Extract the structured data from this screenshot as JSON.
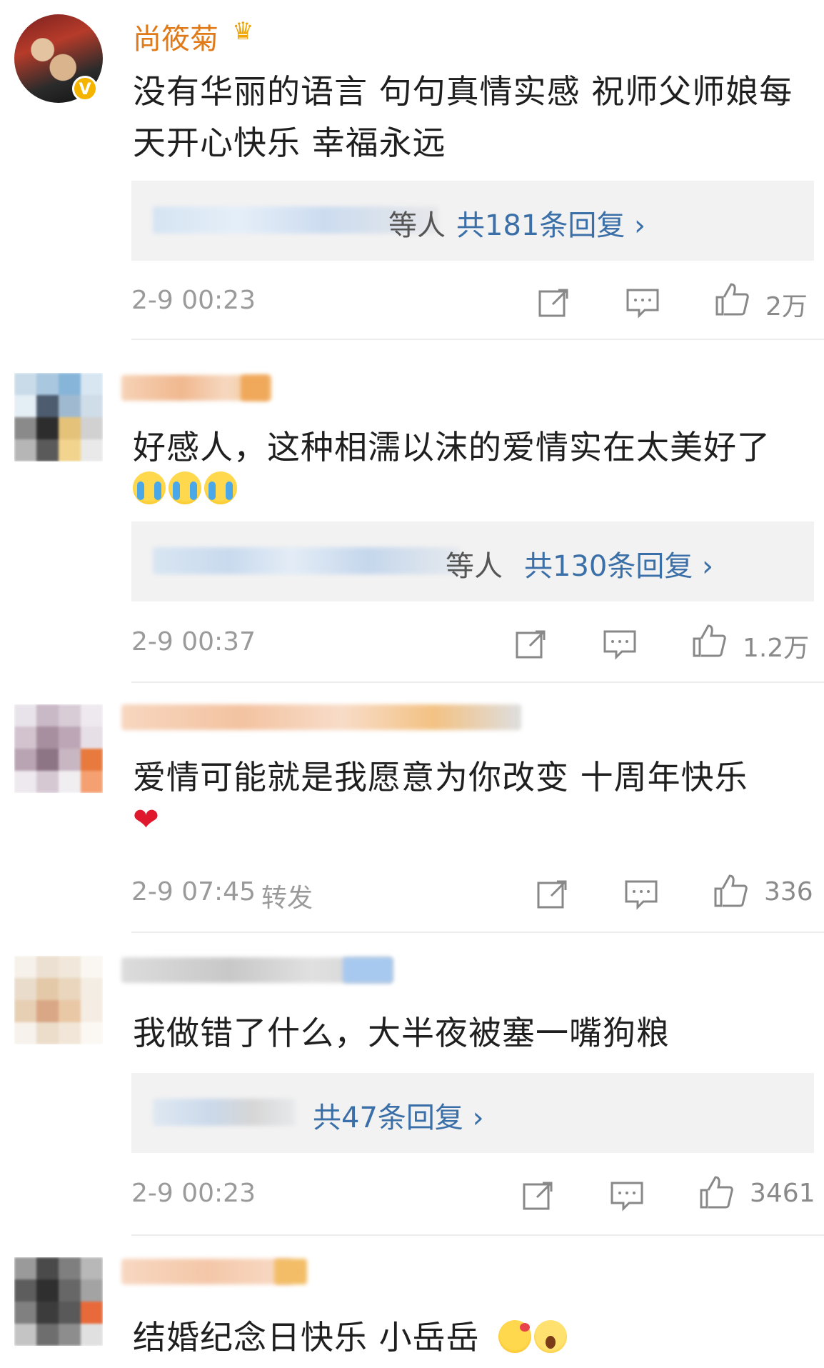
{
  "comments": [
    {
      "username": "尚筱菊",
      "crown_icon": "crown-icon",
      "verified_icon": "verified-v-badge",
      "text": "没有华丽的语言 句句真情实感 祝师父师娘每天开心快乐 幸福永远",
      "replies": {
        "suffix": "等人",
        "count_label": "共181条回复 ›"
      },
      "time": "2-9 00:23",
      "likes": "2万"
    },
    {
      "username": "",
      "text": "好感人，这种相濡以沫的爱情实在太美好了",
      "emoji_icons": [
        "crying-emoji",
        "crying-emoji",
        "crying-emoji"
      ],
      "replies": {
        "suffix": "等人",
        "count_label": "共130条回复 ›"
      },
      "time": "2-9 00:37",
      "likes": "1.2万"
    },
    {
      "username": "",
      "text": "爱情可能就是我愿意为你改变 十周年快乐",
      "emoji_icons": [
        "heart-emoji"
      ],
      "heart_char": "❤",
      "time": "2-9 07:45",
      "forward_label": "转发",
      "likes": "336"
    },
    {
      "username": "",
      "text": "我做错了什么，大半夜被塞一嘴狗粮",
      "replies": {
        "suffix": "",
        "count_label": "共47条回复 ›"
      },
      "time": "2-9 00:23",
      "likes": "3461"
    },
    {
      "username": "",
      "text": "结婚纪念日快乐 小岳岳",
      "emoji_icons": [
        "blowing-kiss-emoji",
        "screaming-emoji"
      ]
    }
  ],
  "colors": {
    "username": "#e07a18",
    "reply_link": "#3a6fa8",
    "meta": "#9a9a9a",
    "reply_bg": "#f2f2f2"
  },
  "action_icons": [
    "share-icon",
    "comment-icon",
    "like-icon"
  ]
}
